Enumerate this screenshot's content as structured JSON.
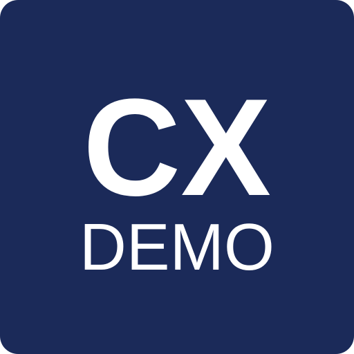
{
  "app_icon": {
    "main_text": "CX",
    "sub_text": "DEMO",
    "background_color": "#1b2a59",
    "text_color": "#ffffff"
  }
}
